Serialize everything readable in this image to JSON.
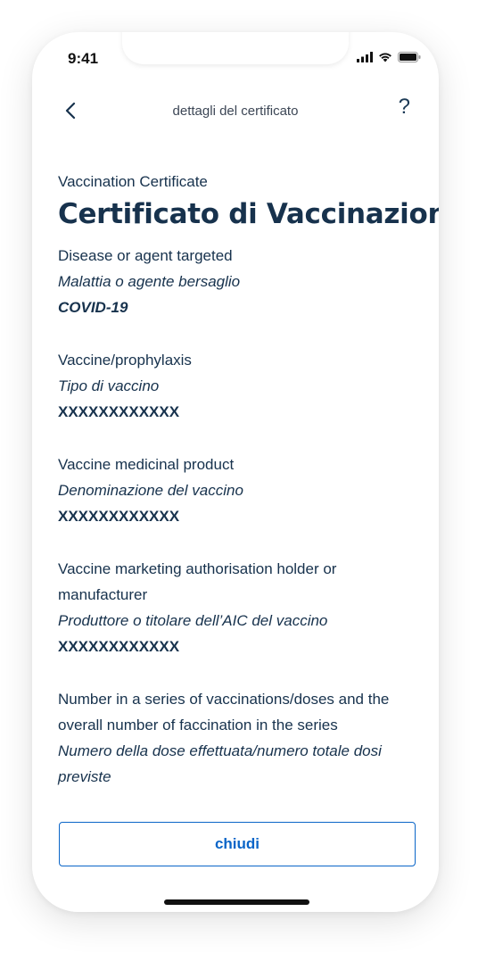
{
  "status_bar": {
    "time": "9:41"
  },
  "nav": {
    "title": "dettagli del certificato",
    "help": "?"
  },
  "header": {
    "eyebrow": "Vaccination Certificate",
    "title": "Certificato di Vaccinazione"
  },
  "fields": [
    {
      "en": "Disease or agent targeted",
      "it": "Malattia o agente bersaglio",
      "value": "COVID-19"
    },
    {
      "en": "Vaccine/prophylaxis",
      "it": "Tipo di vaccino",
      "value": "XXXXXXXXXXXX"
    },
    {
      "en": "Vaccine medicinal product",
      "it": "Denominazione del vaccino",
      "value": "XXXXXXXXXXXX"
    },
    {
      "en": "Vaccine marketing authorisation holder or manufacturer",
      "it": "Produttore o titolare dell’AIC del vaccino",
      "value": "XXXXXXXXXXXX"
    },
    {
      "en": "Number in a series of vaccinations/doses and the overall number of faccination in the series",
      "it": "Numero della dose effettuata/numero totale dosi previste"
    }
  ],
  "footer": {
    "close_label": "chiudi"
  },
  "colors": {
    "text": "#17324d",
    "accent": "#0a65c8"
  },
  "icons": {
    "back": "chevron-left-icon",
    "signal": "cellular-signal-icon",
    "wifi": "wifi-icon",
    "battery": "battery-icon"
  }
}
